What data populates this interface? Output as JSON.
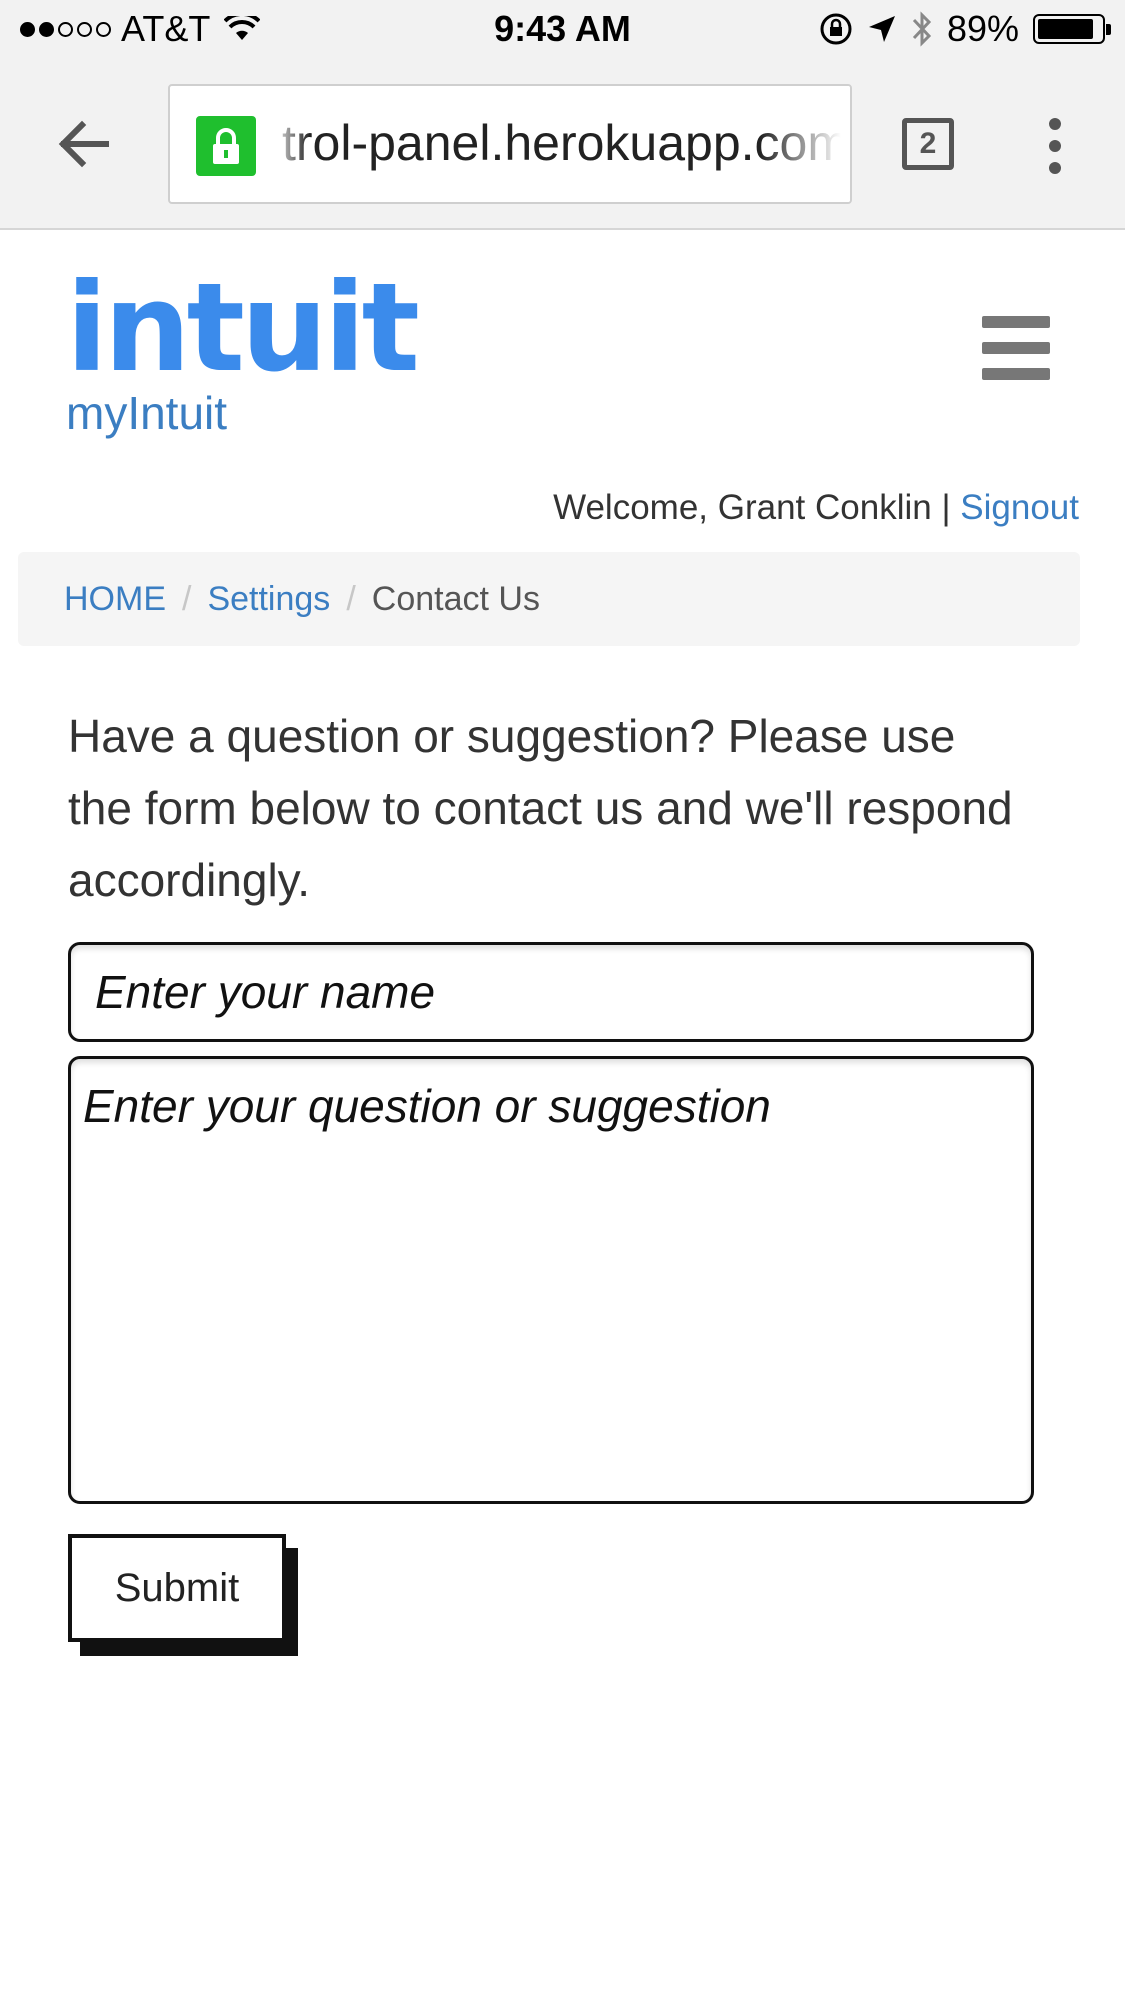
{
  "status_bar": {
    "signal": {
      "filled": 2,
      "total": 5
    },
    "carrier": "AT&T",
    "time": "9:43 AM",
    "battery_text": "89%",
    "battery_level": 0.89,
    "icons": [
      "wifi-icon",
      "rotation-lock-icon",
      "location-icon",
      "bluetooth-icon",
      "battery-icon"
    ]
  },
  "browser": {
    "url_display": "trol-panel.herokuapp.com",
    "tab_count": "2",
    "lock_color": "#1fbf2e",
    "icons": [
      "back-arrow-icon",
      "lock-icon",
      "tabs-icon",
      "overflow-menu-icon"
    ]
  },
  "header": {
    "logo_text": "intuit",
    "logo_color": "#3b8beb",
    "subtitle": "myIntuit",
    "menu_icon": "hamburger-icon"
  },
  "welcome": {
    "prefix": "Welcome, Grant Conklin |",
    "signout_label": "Signout"
  },
  "breadcrumb": {
    "items": [
      "HOME",
      "Settings"
    ],
    "current": "Contact Us",
    "separator": "/"
  },
  "contact": {
    "intro": "Have a question or suggestion? Please use the form below to contact us and we'll respond accordingly.",
    "name_placeholder": "Enter your name",
    "question_placeholder": "Enter your question or suggestion",
    "submit_label": "Submit"
  },
  "colors": {
    "link": "#3b7ec2",
    "brand": "#3b8beb"
  }
}
